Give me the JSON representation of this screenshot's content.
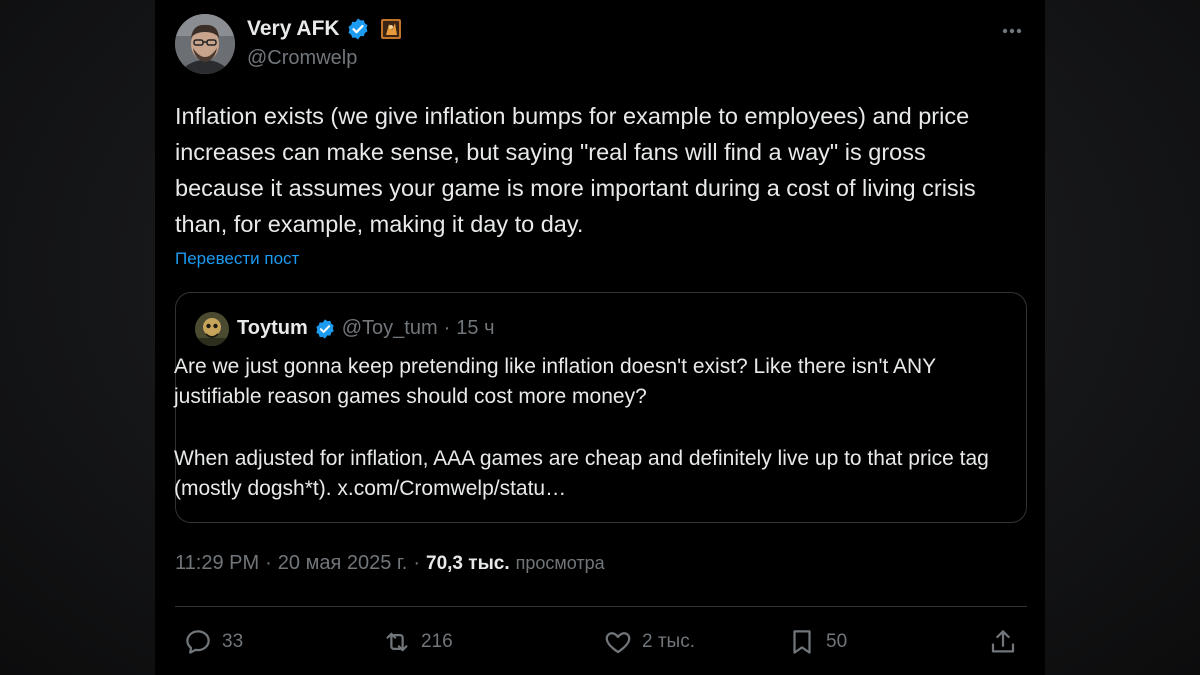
{
  "author": {
    "display_name": "Very AFK",
    "handle": "@Cromwelp",
    "avatar": "person-avatar",
    "verified_icon": "verified-badge-icon",
    "label_icon": "affiliate-label-icon"
  },
  "tweet": {
    "text": "Inflation exists (we give inflation bumps for example to employees) and price increases can make sense, but saying \"real fans will find a way\" is gross because it assumes your game is more important during a cost of living crisis than, for example, making it day to day.",
    "translate_label": "Перевести пост",
    "time": "11:29 PM",
    "date": "20 мая 2025 г.",
    "separator": "·",
    "views_count": "70,3 тыс.",
    "views_label": "просмотра"
  },
  "quote": {
    "display_name": "Toytum",
    "handle": "@Toy_tum",
    "separator": "·",
    "time": "15 ч",
    "paragraph1": "Are we just gonna keep pretending like inflation doesn't exist? Like there isn't ANY justifiable reason games should cost more money?",
    "paragraph2": "When adjusted for inflation, AAA games are cheap and definitely live up to that price tag (mostly dogsh*t). x.com/Cromwelp/statu…"
  },
  "actions": {
    "replies": "33",
    "reposts": "216",
    "likes": "2 тыс.",
    "bookmarks": "50"
  },
  "colors": {
    "background": "#000000",
    "text_primary": "#e7e9ea",
    "text_secondary": "#71767b",
    "accent": "#1d9bf0",
    "border": "#2f3336"
  }
}
